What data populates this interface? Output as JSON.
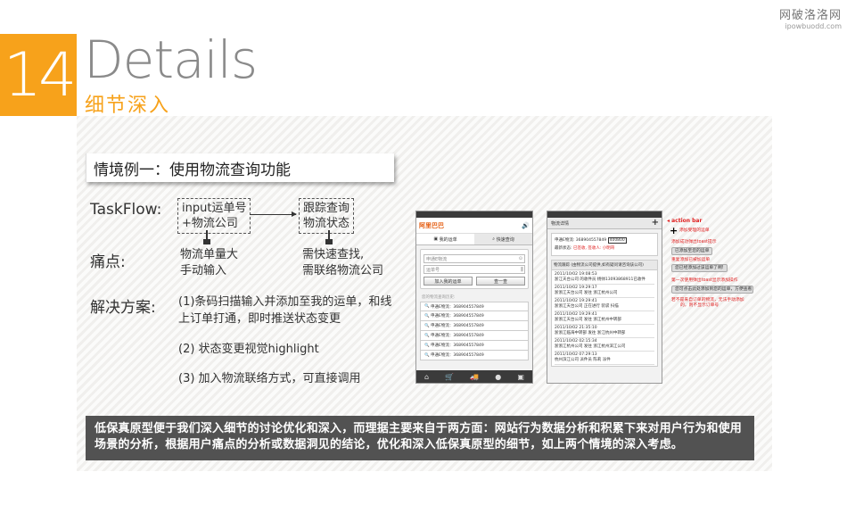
{
  "watermark": {
    "line1": "网破洛洛网",
    "line2": "ipowbuodd.com"
  },
  "header": {
    "number": "14",
    "title": "Details",
    "subtitle": "细节深入"
  },
  "scene": {
    "title": "情境例一：使用物流查询功能"
  },
  "taskflow": {
    "label": "TaskFlow:",
    "step1": "input运单号\n+物流公司",
    "step2": "跟踪查询\n物流状态"
  },
  "pain": {
    "label": "痛点:",
    "item1": "物流单量大\n手动输入",
    "item2": "需快速查找,\n需联络物流公司"
  },
  "solution": {
    "label": "解决方案:",
    "item1": "(1)条码扫描输入并添加至我的运单，和线\n上订单打通，即时推送状态变更",
    "item2": "(2) 状态变更视觉highlight",
    "item3": "(3) 加入物流联络方式，可直接调用"
  },
  "phone1": {
    "logo": "阿里巴巴",
    "tab1": "我的运单",
    "tab2": "快速查询",
    "company_field": "申通E物流",
    "waybill_placeholder": "运单号",
    "btn_add": "加入我的运单",
    "btn_query": "查一查",
    "history_title": "您的物流查询历史:",
    "history": [
      "申通E物流：368904557849",
      "申通E物流：368904557849",
      "申通E物流：368904557849",
      "申通E物流：368904557849",
      "申通E物流：368904557849",
      "申通E物流：368904557849"
    ],
    "nav_icons": [
      "⌂",
      "🛒",
      "🚚",
      "●",
      "▣"
    ]
  },
  "phone2": {
    "title": "物流详情",
    "waybill": "申通E物流: 368904557849",
    "phone": "400800",
    "status_prefix": "最新状态:",
    "status": "已签收, 签收人: 小明哥",
    "track_header": "物流跟踪 (由物流公司提供,如有疑问请咨询该公司)",
    "tracks": [
      "2011/10/02 19:08:53\n浙江天台公司 的收件员 杨帅13093868911已收件",
      "2011/10/02 19:29:17\n浙浙江天台公司 发往 浙江杭州公司",
      "2011/10/02 19:29:41\n浙浙江天台公司 正在进行 装袋 扫描",
      "2011/10/02 19:29:41\n浙浙江天台公司 发往 浙江杭州中转部",
      "2011/10/02 21:35:10\n浙浙江临海中转部 发往 浙江杭州中转部",
      "2011/10/02 02:15:34\n浙浙江杭州公司 发往 浙江杭州滨江公司",
      "2011/10/02 07:29:13\n杭州滨江公司 派件员 陈莉 派件"
    ]
  },
  "annotations": {
    "action_bar": "action bar",
    "a1": "添加受理的运单",
    "a2": "添加成功弹出toast提示",
    "b2": "已添加至您的运单",
    "a3": "重复添加已被加运单",
    "a3b": "被提示已经添加",
    "b3": "您已经添加过该运单了啊!",
    "a4": "第一次使用弹出toast显示添加操作",
    "b4": "您可点击此处添加到您的运单，方便查看!",
    "a5": "若不是来自订单的物流，无法手动添加",
    "a5b": "的，则不显示订单号"
  },
  "footer": "低保真原型便于我们深入细节的讨论优化和深入，而理据主要来自于两方面：网站行为数据分析和积累下来对用户行为和使用场景的分析，根据用户痛点的分析或数据洞见的结论，优化和深入低保真原型的细节，如上两个情境的深入考虑。"
}
